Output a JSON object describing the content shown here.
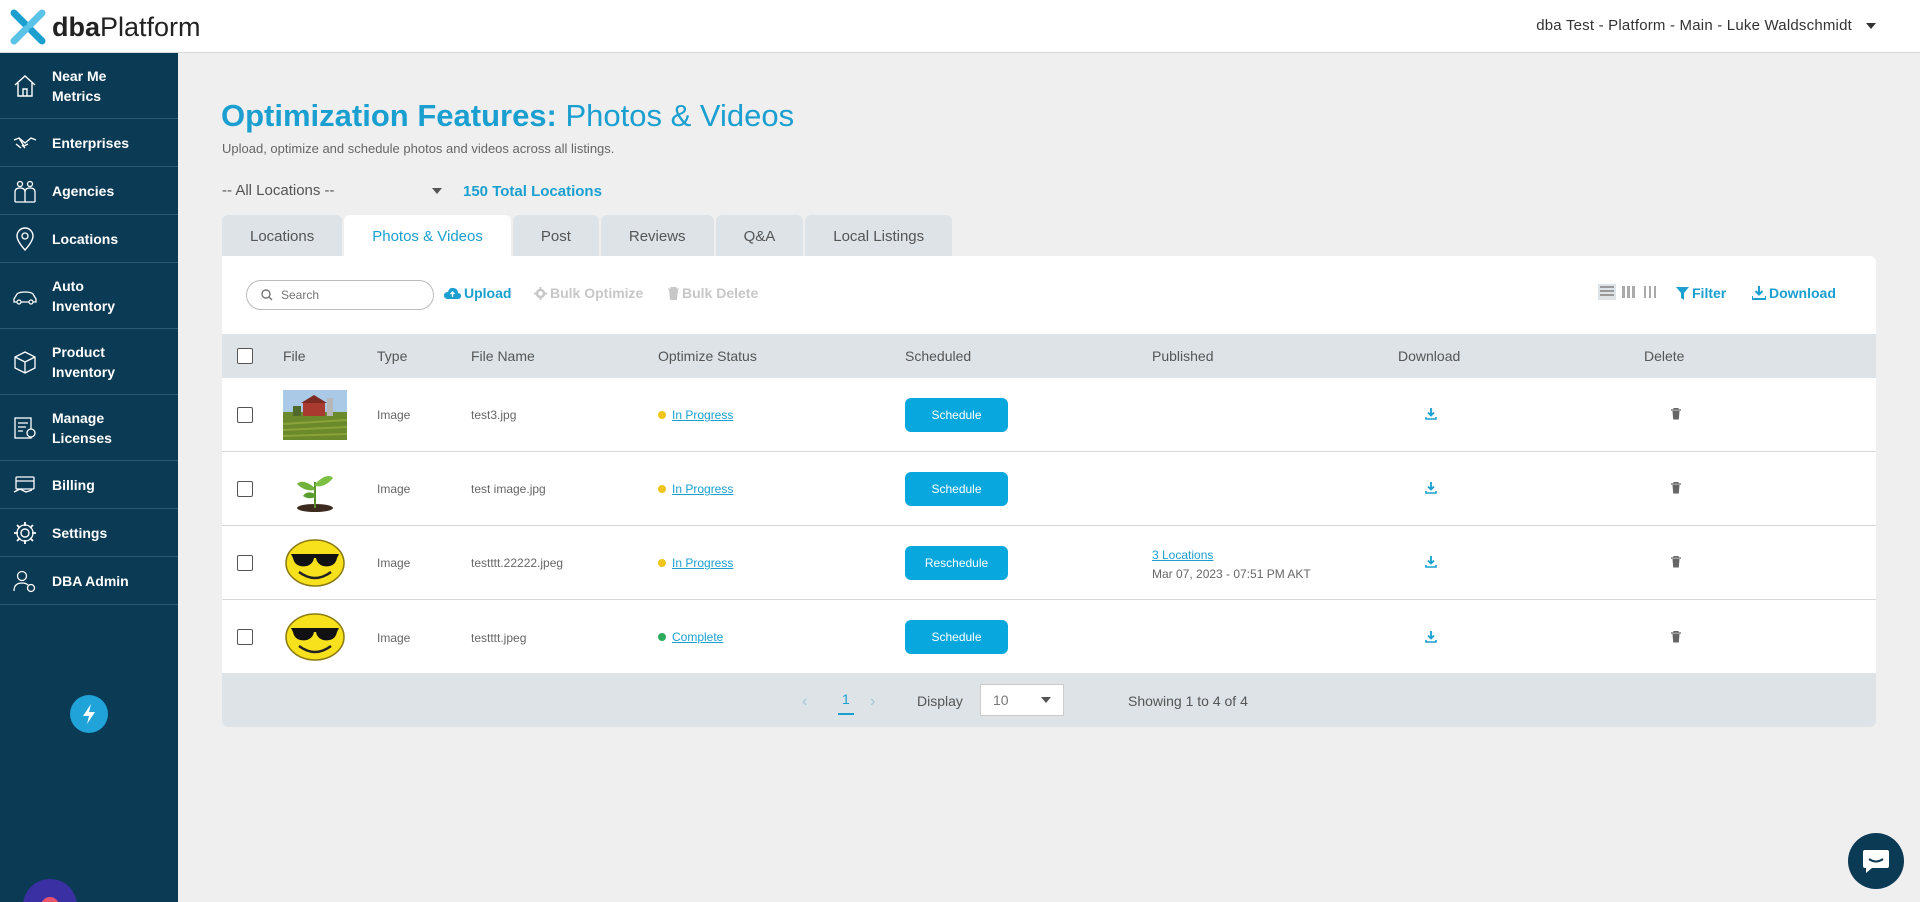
{
  "header": {
    "logo_bold": "dba",
    "logo_light": "Platform",
    "account": "dba Test - Platform - Main - Luke Waldschmidt"
  },
  "sidebar": {
    "items": [
      {
        "label": "Near Me Metrics",
        "icon": "home-icon"
      },
      {
        "label": "Enterprises",
        "icon": "handshake-icon"
      },
      {
        "label": "Agencies",
        "icon": "building-icon"
      },
      {
        "label": "Locations",
        "icon": "map-pin-icon"
      },
      {
        "label": "Auto Inventory",
        "icon": "car-icon"
      },
      {
        "label": "Product Inventory",
        "icon": "box-icon"
      },
      {
        "label": "Manage Licenses",
        "icon": "license-icon"
      },
      {
        "label": "Billing",
        "icon": "billing-icon"
      },
      {
        "label": "Settings",
        "icon": "gear-icon"
      },
      {
        "label": "DBA Admin",
        "icon": "admin-user-icon"
      }
    ]
  },
  "page": {
    "title_bold": "Optimization Features:",
    "title_light": "Photos & Videos",
    "subtitle": "Upload, optimize and schedule photos and videos across all listings.",
    "location_select": "-- All Locations --",
    "total_locations": "150 Total Locations"
  },
  "tabs": [
    "Locations",
    "Photos & Videos",
    "Post",
    "Reviews",
    "Q&A",
    "Local Listings"
  ],
  "toolbar": {
    "search_placeholder": "Search",
    "upload": "Upload",
    "bulk_optimize": "Bulk Optimize",
    "bulk_delete": "Bulk Delete",
    "filter": "Filter",
    "download": "Download"
  },
  "table": {
    "headers": [
      "File",
      "Type",
      "File Name",
      "Optimize Status",
      "Scheduled",
      "Published",
      "Download",
      "Delete"
    ],
    "rows": [
      {
        "type": "Image",
        "file_name": "test3.jpg",
        "status": "In Progress",
        "status_color": "#f0c419",
        "action": "Schedule",
        "published_link": "",
        "published_date": "",
        "thumb": "farm"
      },
      {
        "type": "Image",
        "file_name": "test image.jpg",
        "status": "In Progress",
        "status_color": "#f0c419",
        "action": "Schedule",
        "published_link": "",
        "published_date": "",
        "thumb": "plant"
      },
      {
        "type": "Image",
        "file_name": "testttt.22222.jpeg",
        "status": "In Progress",
        "status_color": "#f0c419",
        "action": "Reschedule",
        "published_link": "3 Locations",
        "published_date": "Mar 07, 2023 - 07:51 PM AKT",
        "thumb": "smiley"
      },
      {
        "type": "Image",
        "file_name": "testttt.jpeg",
        "status": "Complete",
        "status_color": "#2eaa5c",
        "action": "Schedule",
        "published_link": "",
        "published_date": "",
        "thumb": "smiley"
      }
    ]
  },
  "pager": {
    "current_page": "1",
    "display_label": "Display",
    "per_page": "10",
    "showing": "Showing 1 to 4 of 4"
  },
  "colors": {
    "brand": "#1a9fd0",
    "sidebar": "#0b3a55",
    "button": "#08a8df"
  }
}
